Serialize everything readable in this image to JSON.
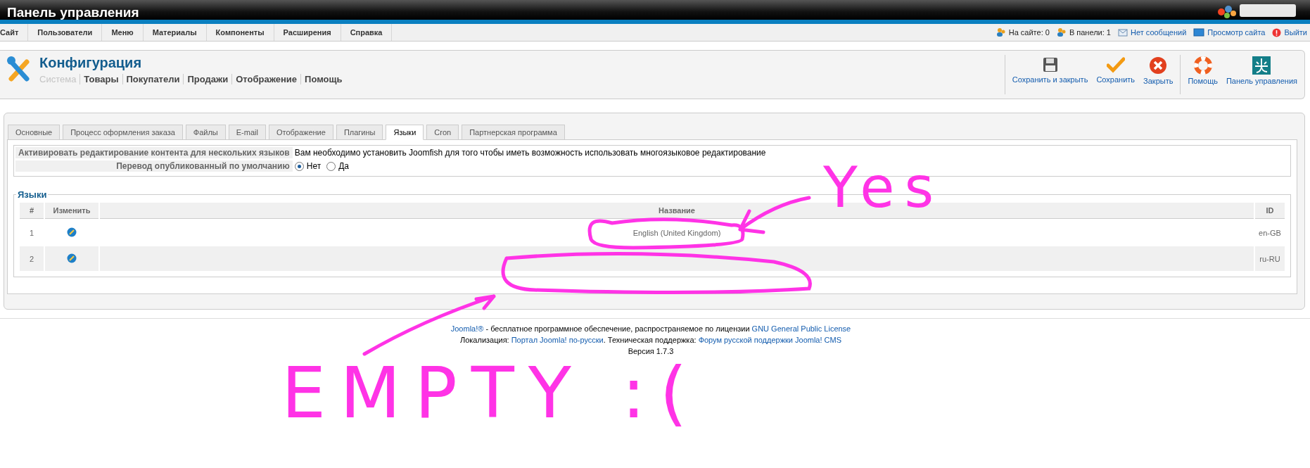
{
  "header": {
    "title": "Панель управления"
  },
  "menu": [
    "Сайт",
    "Пользователи",
    "Меню",
    "Материалы",
    "Компоненты",
    "Расширения",
    "Справка"
  ],
  "status": [
    {
      "kind": "users",
      "label": "На сайте: 0",
      "link": false
    },
    {
      "kind": "users",
      "label": "В панели: 1",
      "link": false
    },
    {
      "kind": "messages",
      "label": "Нет сообщений",
      "link": true
    },
    {
      "kind": "preview",
      "label": "Просмотр сайта",
      "link": true
    },
    {
      "kind": "logout",
      "label": "Выйти",
      "link": true
    }
  ],
  "page": {
    "title": "Конфигурация",
    "submenu": [
      {
        "label": "Система",
        "selected": true
      },
      {
        "label": "Товары",
        "selected": false
      },
      {
        "label": "Покупатели",
        "selected": false
      },
      {
        "label": "Продажи",
        "selected": false
      },
      {
        "label": "Отображение",
        "selected": false
      },
      {
        "label": "Помощь",
        "selected": false
      }
    ]
  },
  "toolbar": [
    {
      "buttons": [
        {
          "kind": "save",
          "label": "Сохранить и закрыть"
        },
        {
          "kind": "apply",
          "label": "Сохранить"
        },
        {
          "kind": "cancel",
          "label": "Закрыть"
        }
      ]
    },
    {
      "buttons": [
        {
          "kind": "help",
          "label": "Помощь"
        },
        {
          "kind": "panel",
          "label": "Панель управления"
        }
      ]
    }
  ],
  "tabs": [
    {
      "label": "Основные",
      "selected": false
    },
    {
      "label": "Процесс оформления заказа",
      "selected": false
    },
    {
      "label": "Файлы",
      "selected": false
    },
    {
      "label": "E-mail",
      "selected": false
    },
    {
      "label": "Отображение",
      "selected": false
    },
    {
      "label": "Плагины",
      "selected": false
    },
    {
      "label": "Языки",
      "selected": true
    },
    {
      "label": "Cron",
      "selected": false
    },
    {
      "label": "Партнерская программа",
      "selected": false
    }
  ],
  "settings": [
    {
      "kind": "text",
      "label": "Активировать редактирование контента для нескольких языков",
      "value": "Вам необходимо установить Joomfish для того чтобы иметь возможность использовать многоязыковое редактирование"
    },
    {
      "kind": "radio",
      "label": "Перевод опубликованный по умолчанию",
      "options": [
        {
          "label": "Нет",
          "selected": true
        },
        {
          "label": "Да",
          "selected": false
        }
      ]
    }
  ],
  "languages": {
    "legend": "Языки",
    "columns": [
      "#",
      "Изменить",
      "Название",
      "ID"
    ],
    "rows": [
      {
        "number": "1",
        "name": "English (United Kingdom)",
        "id": "en-GB"
      },
      {
        "number": "2",
        "id": "ru-RU"
      }
    ]
  },
  "footer": [
    [
      {
        "text": "Joomla!®",
        "link": true
      },
      {
        "text": " - бесплатное программное обеспечение, распространяемое по лицензии ",
        "link": false
      },
      {
        "text": "GNU General Public License",
        "link": true
      }
    ],
    [
      {
        "text": "Локализация: ",
        "link": false
      },
      {
        "text": "Портал Joomla! по-русски",
        "link": true
      },
      {
        "text": ". Техническая поддержка: ",
        "link": false
      },
      {
        "text": "Форум русской поддержки Joomla! CMS",
        "link": true
      }
    ],
    [
      {
        "text": "Версия 1.7.3",
        "link": false
      }
    ]
  ],
  "annotations": {
    "yes_label": "Yes",
    "empty_label": "EMPTY :("
  }
}
